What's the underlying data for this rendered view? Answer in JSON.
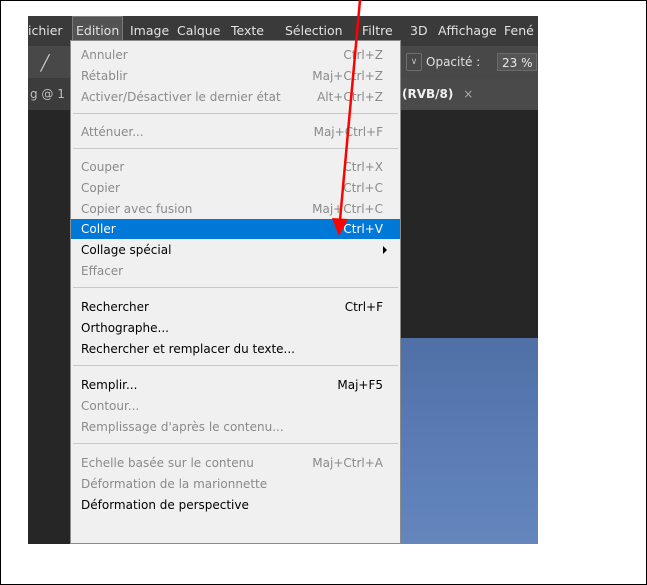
{
  "menubar": {
    "items": [
      "ichier",
      "Edition",
      "Image",
      "Calque",
      "Texte",
      "Sélection",
      "Filtre",
      "3D",
      "Affichage",
      "Fené"
    ]
  },
  "options_bar": {
    "opacity_label": "Opacité :",
    "opacity_value": "23 %"
  },
  "tabs": {
    "left": "g @ 1",
    "right_mode": "(RVB/8)",
    "close": "×"
  },
  "edit_menu": {
    "items": [
      {
        "label": "Annuler",
        "shortcut": "Ctrl+Z",
        "enabled": false
      },
      {
        "label": "Rétablir",
        "shortcut": "Maj+Ctrl+Z",
        "enabled": false
      },
      {
        "label": "Activer/Désactiver le dernier état",
        "shortcut": "Alt+Ctrl+Z",
        "enabled": false
      },
      {
        "label": "Atténuer...",
        "shortcut": "Maj+Ctrl+F",
        "enabled": false
      },
      {
        "label": "Couper",
        "shortcut": "Ctrl+X",
        "enabled": false
      },
      {
        "label": "Copier",
        "shortcut": "Ctrl+C",
        "enabled": false
      },
      {
        "label": "Copier avec fusion",
        "shortcut": "Maj+Ctrl+C",
        "enabled": false
      },
      {
        "label": "Coller",
        "shortcut": "Ctrl+V",
        "enabled": true,
        "highlighted": true
      },
      {
        "label": "Collage spécial",
        "shortcut": "",
        "enabled": true,
        "submenu": true
      },
      {
        "label": "Effacer",
        "shortcut": "",
        "enabled": false
      },
      {
        "label": "Rechercher",
        "shortcut": "Ctrl+F",
        "enabled": true
      },
      {
        "label": "Orthographe...",
        "shortcut": "",
        "enabled": true
      },
      {
        "label": "Rechercher et remplacer du texte...",
        "shortcut": "",
        "enabled": true
      },
      {
        "label": "Remplir...",
        "shortcut": "Maj+F5",
        "enabled": true
      },
      {
        "label": "Contour...",
        "shortcut": "",
        "enabled": false
      },
      {
        "label": "Remplissage d'après le contenu...",
        "shortcut": "",
        "enabled": false
      },
      {
        "label": "Echelle basée sur le contenu",
        "shortcut": "Maj+Ctrl+A",
        "enabled": false
      },
      {
        "label": "Déformation de la marionnette",
        "shortcut": "",
        "enabled": false
      },
      {
        "label": "Déformation de perspective",
        "shortcut": "",
        "enabled": true
      }
    ]
  },
  "colors": {
    "highlight": "#0078d7",
    "arrow": "#ff0000"
  }
}
